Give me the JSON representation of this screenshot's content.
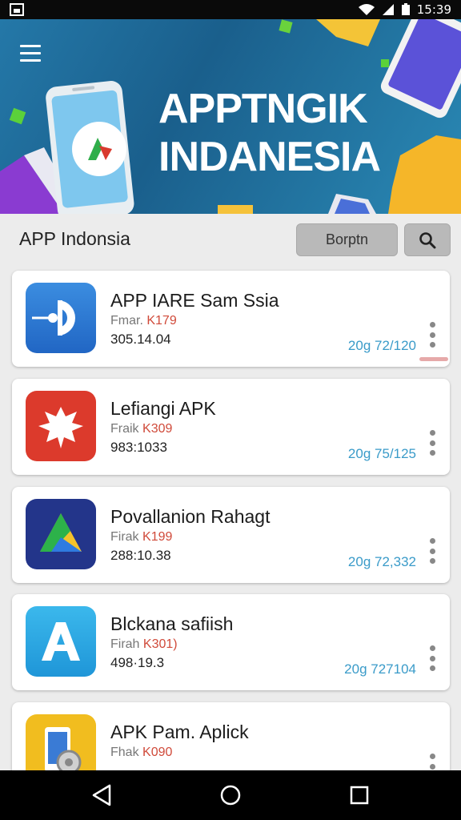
{
  "status_bar": {
    "time": "15:39"
  },
  "hero": {
    "title_line1": "APPTNGIK",
    "title_line2": "INDANESIA"
  },
  "toolbar": {
    "title": "APP Indonsia",
    "button_label": "Borptn"
  },
  "icons": {
    "menu": "hamburger-menu-icon",
    "search": "search-icon",
    "more": "vertical-dots-icon",
    "back": "back-triangle-icon",
    "home": "home-circle-icon",
    "recents": "recents-square-icon"
  },
  "colors": {
    "hero_bg": "#1f6f9e",
    "price": "#d04a3a",
    "rating": "#3a9bc9"
  },
  "apps": [
    {
      "name": "APP IARE Sam Ssia",
      "meta_label": "Fmar.",
      "price": "K179",
      "size": "305.14.04",
      "rating": "20g 72/120",
      "icon": "blue-d-icon"
    },
    {
      "name": "Lefiangi APK",
      "meta_label": "Fraik",
      "price": "K309",
      "size": "983:1033",
      "rating": "20g 75/125",
      "icon": "red-eagle-icon"
    },
    {
      "name": "Povallanion Rahagt",
      "meta_label": "Firak",
      "price": "K199",
      "size": "288:10.38",
      "rating": "20g 72,332",
      "icon": "triangle-logo-icon"
    },
    {
      "name": "Blckana safiish",
      "meta_label": "Firah",
      "price": "K301)",
      "size": "498·19.3",
      "rating": "20g 727104",
      "icon": "letter-a-icon"
    },
    {
      "name": "APK Pam. Aplick",
      "meta_label": "Fhak",
      "price": "K090",
      "size": "",
      "rating": "",
      "icon": "phone-gear-icon"
    }
  ]
}
